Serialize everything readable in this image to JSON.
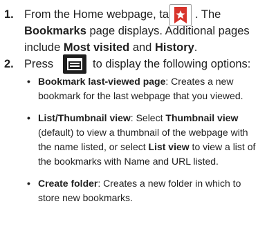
{
  "steps": [
    {
      "number": "1.",
      "lines": [
        {
          "a": "From the Home webpage, tap",
          "b": ". The"
        },
        {
          "a_bold": "Bookmarks",
          "a": " page displays. Additional pages"
        },
        {
          "a": "include ",
          "b_bold": "Most visited",
          "b": " and ",
          "c_bold": "History",
          "c": "."
        }
      ],
      "icon": "bookmark-star-icon"
    },
    {
      "number": "2.",
      "press": "Press",
      "press_rest": "to display the following options:",
      "icon": "menu-icon",
      "bullets": [
        {
          "bold": "Bookmark last-viewed page",
          "text_line1": ": Creates a new",
          "text_line2": "bookmark for the last webpage that you viewed."
        },
        {
          "bold": "List/Thumbnail view",
          "text_line1_a": ": Select ",
          "text_line1_bold": "Thumbnail view",
          "text_line2": "(default) to view a thumbnail of the webpage with",
          "text_line3_a": "the name listed, or select ",
          "text_line3_bold": "List view",
          "text_line3_b": " to view a list of",
          "text_line4": "the bookmarks with Name and URL listed."
        },
        {
          "bold": "Create folder",
          "text_line1": ": Creates a new folder in which to",
          "text_line2": "store new bookmarks."
        }
      ]
    }
  ],
  "colors": {
    "text": "#1f1f1f",
    "bookmark_icon": "#d8342c",
    "menu_icon": "#1e1e1e"
  }
}
